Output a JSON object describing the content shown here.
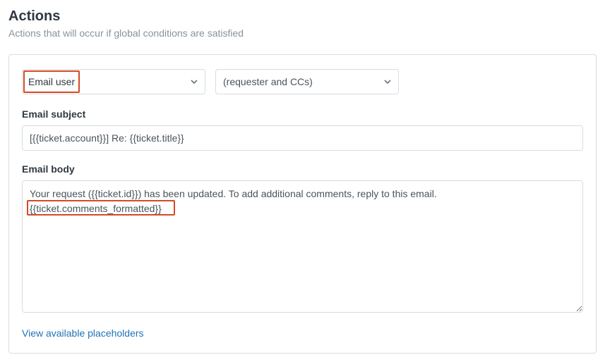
{
  "header": {
    "title": "Actions",
    "subtitle": "Actions that will occur if global conditions are satisfied"
  },
  "action": {
    "type_label": "Email user",
    "target_label": "(requester and CCs)"
  },
  "fields": {
    "subject_label": "Email subject",
    "subject_value": "[{{ticket.account}}] Re: {{ticket.title}}",
    "body_label": "Email body",
    "body_value": "Your request ({{ticket.id}}) has been updated. To add additional comments, reply to this email.\n{{ticket.comments_formatted}}"
  },
  "links": {
    "placeholders": "View available placeholders"
  },
  "highlight": {
    "body_token": "{{ticket.comments_formatted}}"
  }
}
